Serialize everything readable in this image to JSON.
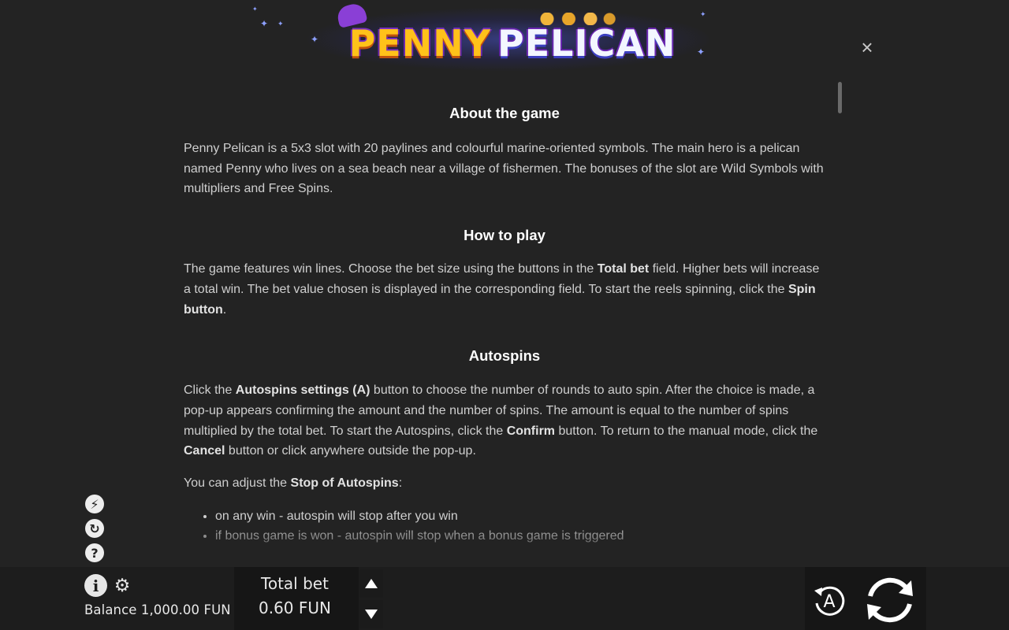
{
  "game": {
    "title_part1": "PENNY",
    "title_part2": "PELICAN"
  },
  "close": {
    "icon": "×"
  },
  "rules": {
    "about": {
      "heading": "About the game",
      "text": "Penny Pelican is a 5x3 slot with 20 paylines and colourful marine-oriented symbols. The main hero is a pelican named Penny who lives on a sea beach near a village of fishermen. The bonuses of the slot are Wild Symbols with multipliers and Free Spins."
    },
    "how_to_play": {
      "heading": "How to play",
      "t1": "The game features win lines. Choose the bet size using the buttons in the ",
      "b1": "Total bet",
      "t2": " field. Higher bets will increase a total win. The bet value chosen is displayed in the corresponding field. To start the reels spinning, click the ",
      "b2": "Spin button",
      "t3": "."
    },
    "autospins": {
      "heading": "Autospins",
      "t1": "Click the ",
      "b1": "Autospins settings (A)",
      "t2": " button to choose the number of rounds to auto spin. After the choice is made, a pop-up appears confirming the amount and the number of spins. The amount is equal to the number of spins multiplied by the total bet. To start the Autospins, click the ",
      "b2": "Confirm",
      "t3": " button. To return to the manual mode, click the ",
      "b3": "Cancel",
      "t4": " button or click anywhere outside the pop-up.",
      "stop_t1": "You can adjust the ",
      "stop_b1": "Stop of Autospins",
      "stop_t2": ":",
      "stop_items": [
        "on any win - autospin will stop after you win",
        "if bonus game is won - autospin will stop when a bonus game is triggered"
      ]
    }
  },
  "side_icons": [
    {
      "name": "turbo-icon",
      "glyph": "⚡"
    },
    {
      "name": "quickspin-icon",
      "glyph": "↻"
    },
    {
      "name": "help-icon",
      "glyph": "?"
    }
  ],
  "footer": {
    "info_glyph": "i",
    "gear_glyph": "⚙",
    "balance": "Balance 1,000.00 FUN",
    "total_bet_label": "Total bet",
    "total_bet_value": "0.60 FUN",
    "auto_label": "A"
  }
}
